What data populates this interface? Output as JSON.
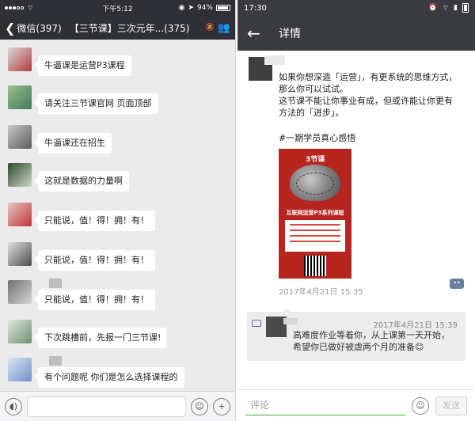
{
  "left": {
    "status": {
      "time": "下午5:12",
      "battery": "94%"
    },
    "nav": {
      "back_label": "微信(397)",
      "title": "【三节课】三次元年...(375)"
    },
    "messages": [
      {
        "text": "牛逼课是运营P3课程",
        "avatar_color": "#b43a3a"
      },
      {
        "text": "请关注三节课官网 页面顶部",
        "avatar_color": "#3e7a5c"
      },
      {
        "text": "牛逼课还在招生",
        "avatar_color": "#5a5a5a"
      },
      {
        "text": "这就是数据的力量啊",
        "avatar_color": "#2b4a2b"
      },
      {
        "text": "只能说，值！得！拥！有！",
        "avatar_color": "#c23232"
      },
      {
        "text": "只能说，值！得！拥！有！",
        "avatar_color": "#4d4d4d"
      },
      {
        "text": "只能说，值！得！拥！有！",
        "avatar_color": "#707070"
      },
      {
        "text": "下次跳槽前，先报一门三节课!",
        "avatar_color": "#6d8f6f"
      },
      {
        "text": "有个问题呢 你们是怎么选择课程的",
        "avatar_color": "#7391c9"
      }
    ]
  },
  "right": {
    "status": {
      "time": "17:30"
    },
    "nav": {
      "title": "详情"
    },
    "post": {
      "lines": [
        "如果你想深造「运营」，有更系统的思维方式，",
        "那么你可以试试。",
        "这节课不能让你事业有成，但或许能让你更有",
        "方法的「进步」。"
      ],
      "tag": "#一期学员真心感悟",
      "image": {
        "logo": "3节课",
        "title": "互联网运营P3系列课程"
      },
      "date": "2017年4月21日 15:35"
    },
    "comment": {
      "time": "2017年4月21日 15:39",
      "lines": [
        "高难度作业等着你，从上课第一天开始，",
        "希望你已做好被虐两个月的准备😊"
      ]
    },
    "input": {
      "placeholder": "评论",
      "send_label": "发送"
    }
  }
}
